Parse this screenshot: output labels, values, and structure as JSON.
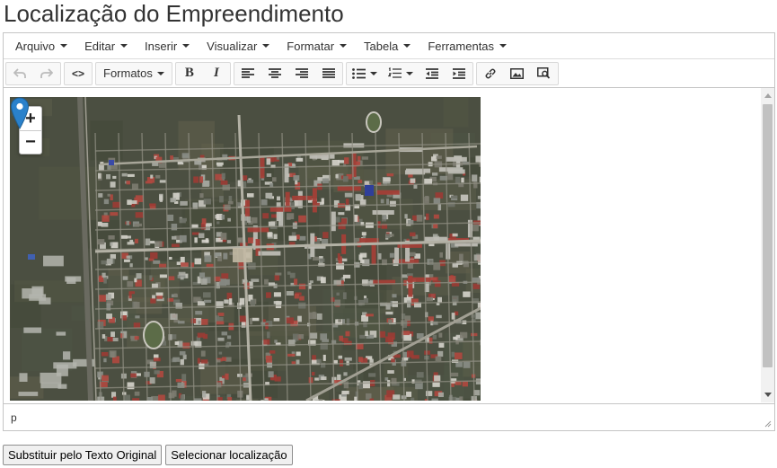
{
  "page": {
    "title": "Localização do Empreendimento"
  },
  "menubar": {
    "items": [
      {
        "label": "Arquivo"
      },
      {
        "label": "Editar"
      },
      {
        "label": "Inserir"
      },
      {
        "label": "Visualizar"
      },
      {
        "label": "Formatar"
      },
      {
        "label": "Tabela"
      },
      {
        "label": "Ferramentas"
      }
    ]
  },
  "toolbar": {
    "formats_label": "Formatos",
    "bold_label": "B",
    "italic_label": "I",
    "source_code_label": "<>",
    "icons": [
      "undo-icon",
      "redo-icon",
      "source-code-icon",
      "bold-icon",
      "italic-icon",
      "align-left-icon",
      "align-center-icon",
      "align-right-icon",
      "align-justify-icon",
      "bullet-list-icon",
      "numbered-list-icon",
      "outdent-icon",
      "indent-icon",
      "link-icon",
      "image-icon",
      "preview-icon"
    ]
  },
  "map": {
    "zoom_in_label": "+",
    "zoom_out_label": "−",
    "marker_color": "#2a81cb",
    "icons": [
      "map-marker-icon"
    ]
  },
  "statusbar": {
    "path": "p"
  },
  "buttons": {
    "restore_label": "Substituir pelo Texto Original",
    "select_location_label": "Selecionar localização"
  },
  "colors": {
    "border": "#c5c5c5",
    "text": "#333333"
  }
}
